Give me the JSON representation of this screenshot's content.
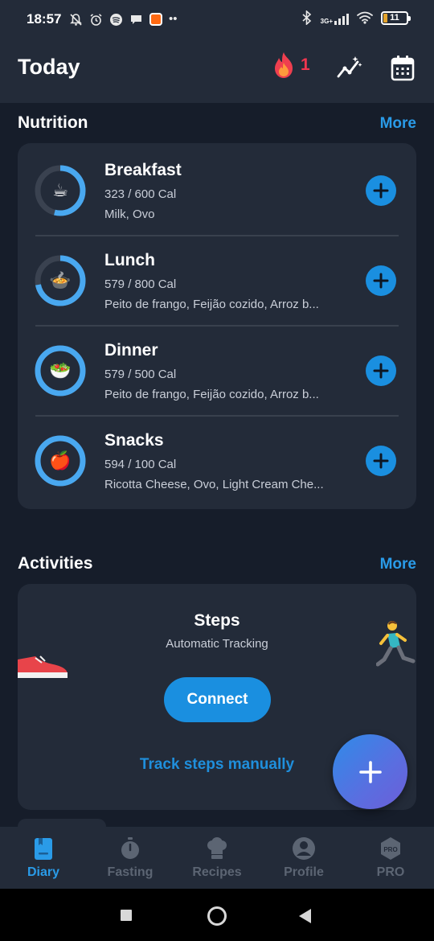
{
  "status_bar": {
    "time": "18:57",
    "network_label": "3G+",
    "battery": "11"
  },
  "header": {
    "title": "Today",
    "streak_count": "1",
    "icons": [
      "fire-icon",
      "trend-chart-icon",
      "calendar-icon"
    ]
  },
  "nutrition": {
    "title": "Nutrition",
    "more_label": "More",
    "meals": [
      {
        "name": "Breakfast",
        "calories": "323 / 600 Cal",
        "items": "Milk, Ovo",
        "emoji": "☕",
        "progress": 0.54
      },
      {
        "name": "Lunch",
        "calories": "579 / 800 Cal",
        "items": "Peito de frango, Feijão cozido, Arroz b...",
        "emoji": "🍲",
        "progress": 0.72
      },
      {
        "name": "Dinner",
        "calories": "579 / 500 Cal",
        "items": "Peito de frango, Feijão cozido, Arroz b...",
        "emoji": "🥗",
        "progress": 1.0
      },
      {
        "name": "Snacks",
        "calories": "594 / 100 Cal",
        "items": "Ricotta Cheese, Ovo, Light Cream Che...",
        "emoji": "🍎",
        "progress": 1.0
      }
    ]
  },
  "activities": {
    "title": "Activities",
    "more_label": "More",
    "steps_title": "Steps",
    "steps_subtitle": "Automatic Tracking",
    "connect_label": "Connect",
    "manual_label": "Track steps manually"
  },
  "bottom_nav": [
    {
      "label": "Diary",
      "icon": "diary-icon",
      "active": true
    },
    {
      "label": "Fasting",
      "icon": "stopwatch-icon",
      "active": false
    },
    {
      "label": "Recipes",
      "icon": "chef-hat-icon",
      "active": false
    },
    {
      "label": "Profile",
      "icon": "profile-icon",
      "active": false
    },
    {
      "label": "PRO",
      "icon": "pro-badge-icon",
      "active": false
    }
  ],
  "pro_badge_text": "PRO",
  "colors": {
    "background": "#161d2a",
    "card": "#232b39",
    "accent": "#1a8fe0",
    "ring": "#49a8f0",
    "streak": "#f0364f",
    "inactive": "#5c6573"
  }
}
